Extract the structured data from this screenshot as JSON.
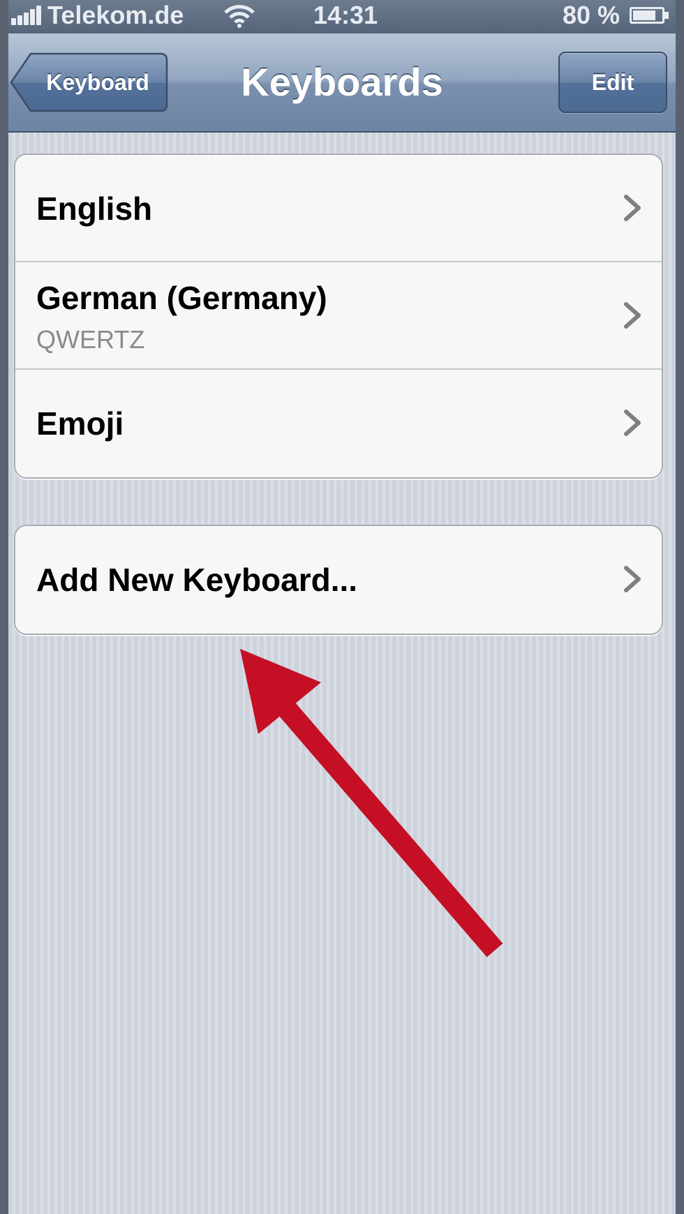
{
  "status_bar": {
    "carrier": "Telekom.de",
    "time": "14:31",
    "battery_percent": "80 %",
    "battery_level": 0.8,
    "signal_bars": 5,
    "icons": [
      "signal-bars-icon",
      "wifi-icon",
      "battery-icon"
    ]
  },
  "nav_bar": {
    "back_label": "Keyboard",
    "title": "Keyboards",
    "edit_label": "Edit"
  },
  "keyboards": [
    {
      "label": "English",
      "detail": ""
    },
    {
      "label": "German (Germany)",
      "detail": "QWERTZ"
    },
    {
      "label": "Emoji",
      "detail": ""
    }
  ],
  "add_keyboard": {
    "label": "Add New Keyboard..."
  },
  "colors": {
    "nav_bar": "#7a90ae",
    "background": "#d3d8e0",
    "annotation_arrow": "#c40f24",
    "chevron": "#7f7f7f"
  }
}
